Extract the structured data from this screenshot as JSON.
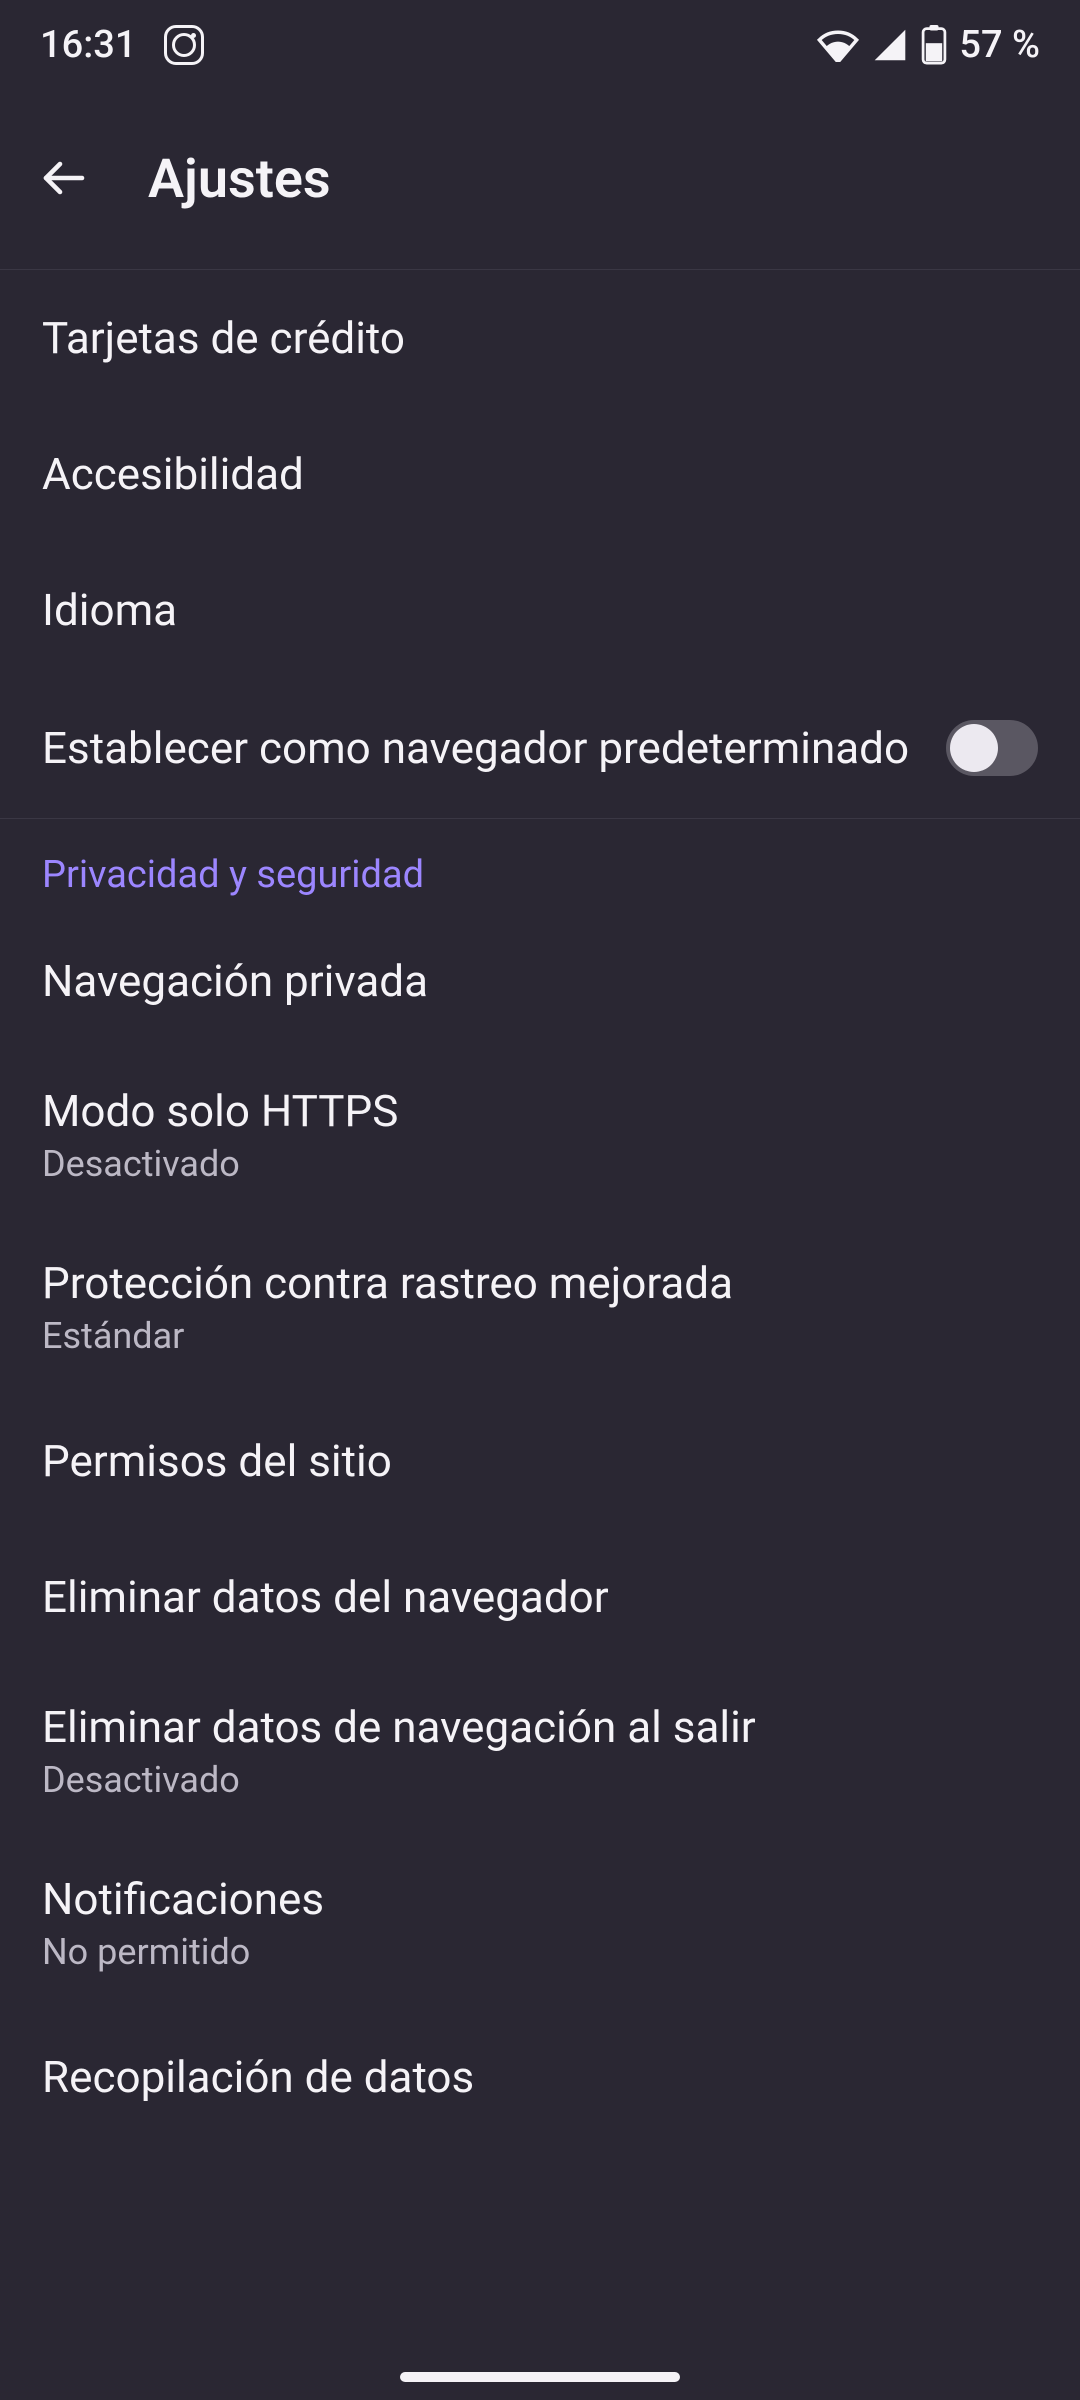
{
  "status": {
    "time": "16:31",
    "battery": "57 %"
  },
  "appbar": {
    "title": "Ajustes"
  },
  "items": {
    "credit_cards": "Tarjetas de crédito",
    "accessibility": "Accesibilidad",
    "language": "Idioma",
    "default_browser": "Establecer como navegador predeterminado"
  },
  "section": {
    "privacy": "Privacidad y seguridad"
  },
  "privacy": {
    "private_browsing": "Navegación privada",
    "https_only": {
      "title": "Modo solo HTTPS",
      "sub": "Desactivado"
    },
    "tracking": {
      "title": "Protección contra rastreo mejorada",
      "sub": "Estándar"
    },
    "site_permissions": "Permisos del sitio",
    "clear_data": "Eliminar datos del navegador",
    "clear_on_exit": {
      "title": "Eliminar datos de navegación al salir",
      "sub": "Desactivado"
    },
    "notifications": {
      "title": "Notificaciones",
      "sub": "No permitido"
    },
    "data_collection": "Recopilación de datos"
  }
}
